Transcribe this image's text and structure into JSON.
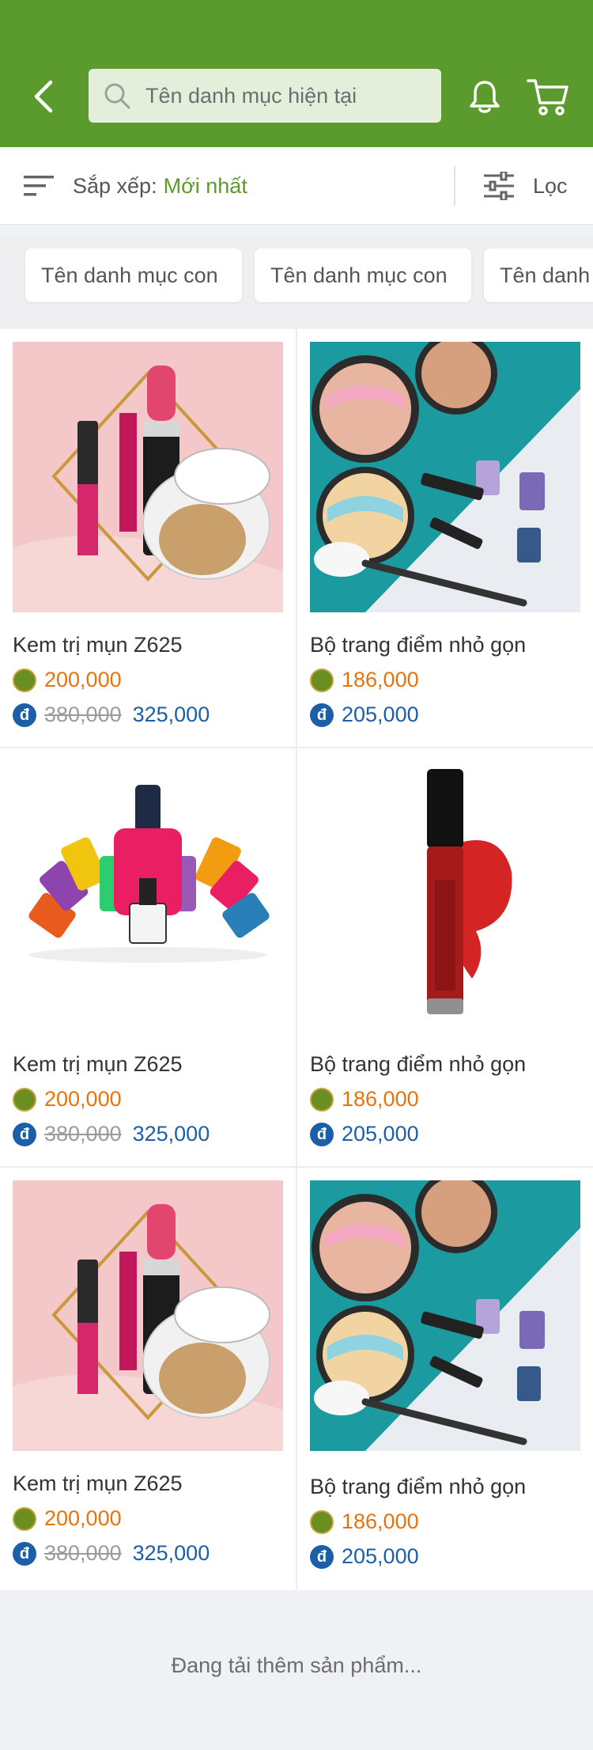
{
  "header": {
    "search_placeholder": "Tên danh mục hiện tại",
    "back_icon": "back-arrow-icon",
    "bell_icon": "bell-icon",
    "cart_icon": "cart-icon"
  },
  "sortbar": {
    "sort_label": "Sắp xếp:",
    "sort_value": "Mới nhất",
    "filter_label": "Lọc"
  },
  "chips": [
    "Tên danh mục con",
    "Tên danh mục con",
    "Tên danh mục con"
  ],
  "products": [
    {
      "name": "Kem trị mụn Z625",
      "points_price": "200,000",
      "old_price": "380,000",
      "price": "325,000"
    },
    {
      "name": "Bộ trang điểm nhỏ gọn",
      "points_price": "186,000",
      "old_price": "",
      "price": "205,000"
    },
    {
      "name": "Kem trị mụn Z625",
      "points_price": "200,000",
      "old_price": "380,000",
      "price": "325,000"
    },
    {
      "name": "Bộ trang điểm nhỏ gọn",
      "points_price": "186,000",
      "old_price": "",
      "price": "205,000"
    },
    {
      "name": "Kem trị mụn Z625",
      "points_price": "200,000",
      "old_price": "380,000",
      "price": "325,000"
    },
    {
      "name": "Bộ trang điểm nhỏ gọn",
      "points_price": "186,000",
      "old_price": "",
      "price": "205,000"
    }
  ],
  "loading_text": "Đang tải thêm sản phẩm...",
  "colors": {
    "brand_green": "#5b9a2c",
    "points_orange": "#e8730c",
    "price_blue": "#1b5fa8"
  }
}
